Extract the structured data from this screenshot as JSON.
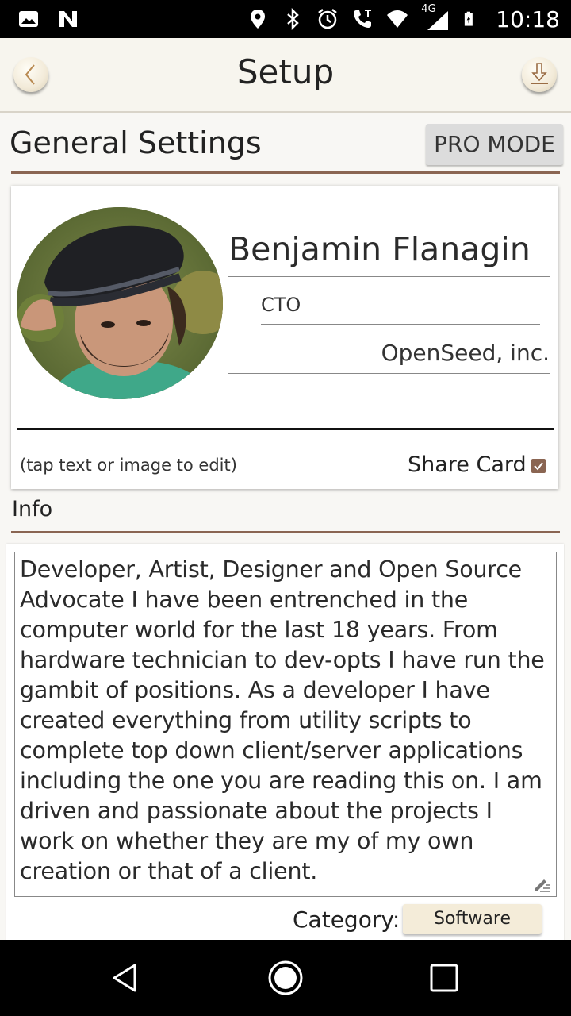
{
  "status_bar": {
    "time": "10:18",
    "network": "4G",
    "icons": [
      "image-icon",
      "n-icon",
      "location-icon",
      "bluetooth-icon",
      "alarm-icon",
      "call-icon",
      "wifi-icon",
      "signal-icon",
      "battery-icon"
    ]
  },
  "app_bar": {
    "title": "Setup",
    "back_icon": "back-icon",
    "download_icon": "download-icon"
  },
  "general": {
    "title": "General Settings",
    "pro_mode_label": "PRO MODE"
  },
  "card": {
    "name": "Benjamin Flanagin",
    "role": "CTO",
    "company": "OpenSeed, inc.",
    "hint": "(tap text or image to edit)",
    "share_label": "Share Card",
    "share_checked": true
  },
  "info": {
    "label": "Info",
    "lines": [
      "Developer, Artist, Designer and Open Source",
      "Advocate I have been entrenched in the",
      "computer world for the last 18 years. From",
      "hardware technician to dev-opts I have run the",
      "gambit of positions. As a developer I have",
      "created everything from utility scripts to",
      "complete top down client/server applications",
      "including the one you are reading this on. I am",
      "driven and passionate about the projects I",
      "work on whether they are my of my own",
      "creation or that of a client."
    ],
    "category_label": "Category:",
    "category_value": "Software"
  },
  "colors": {
    "accent": "#8a6552",
    "appbar_bg": "#f7f5ee",
    "category_bg": "#f4ecd9"
  }
}
